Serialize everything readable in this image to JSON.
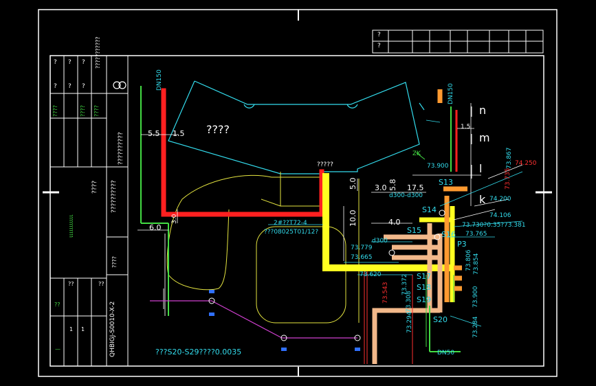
{
  "drawing": {
    "room_label": "????",
    "pipe_label_left": "DN150",
    "pipe_label_right": "DN150",
    "pipe_label_bottom": "DN50",
    "top_label": "?????",
    "dim_5_5": "5.5",
    "dim_1_5": "1.5",
    "dim_6_0": "6.0",
    "dim_3_0_left": "3.0",
    "dim_3_0": "3.0",
    "dim_5_8": "5.8",
    "dim_5_0": "5.0",
    "dim_17_5": "17.5",
    "dim_10_0": "10.0",
    "dim_4_0": "4.0",
    "dim_1_5_right": "1.5",
    "note_1": "2#??T72-4",
    "note_2": "???08025T01/12?",
    "note_3": "d300-d300",
    "note_4": "d300",
    "footer_note": "???S20-S29????0.0035",
    "zk_label": "ZK",
    "axis_n": "n",
    "axis_m": "m",
    "axis_l": "l",
    "axis_k": "k",
    "elev": {
      "e73_900": "73.900",
      "e73_867": "73.867",
      "e74_250": "74.250",
      "e73_735": "73.735",
      "e74_200": "74.200",
      "e74_106": "74.106",
      "e73_730": "73.730?0.35?73.381",
      "e73_765": "73.765",
      "e73_779": "73.779",
      "e73_665": "73.665",
      "e73_620": "73.620",
      "e73_806": "73.806",
      "e73_854": "73.854",
      "e73_543": "73.543",
      "e73_372": "73.372",
      "e73_308": "73.308",
      "e73_294": "73.294",
      "e73_900b": "73.900",
      "e73_284": "73.284"
    },
    "s_labels": {
      "s13": "S13",
      "s14": "S14",
      "s15": "S15",
      "s16": "S16",
      "p3": "P3",
      "s17": "S17",
      "s18": "S18",
      "s19": "S19",
      "s20": "S20"
    }
  },
  "title_block": {
    "rev_rows": [
      "?",
      "?"
    ],
    "left_col": [
      "?",
      "?",
      "?",
      "?",
      "?",
      "?"
    ],
    "green_1": "????",
    "green_2": "????",
    "green_3": "????",
    "company": "???????????",
    "vertical_main": "??????????",
    "wavy_text": "ιιιιιιιιιιι",
    "block_mid": "????",
    "drawing_no": "QHBIGJ-S0010-X-2",
    "block_bottom_labels": [
      "??",
      "??",
      "??"
    ],
    "block_bottom_values": [
      "1",
      "1"
    ],
    "block_bottom_green": "—"
  },
  "colors": {
    "frame": "#ffffff",
    "cyan": "#33ddee",
    "green": "#44dd44",
    "red": "#ff2020",
    "yellow": "#ffff20",
    "orange": "#ff9a30",
    "peach": "#f2b88a",
    "magenta": "#d040d0",
    "blue": "#3070ff"
  }
}
